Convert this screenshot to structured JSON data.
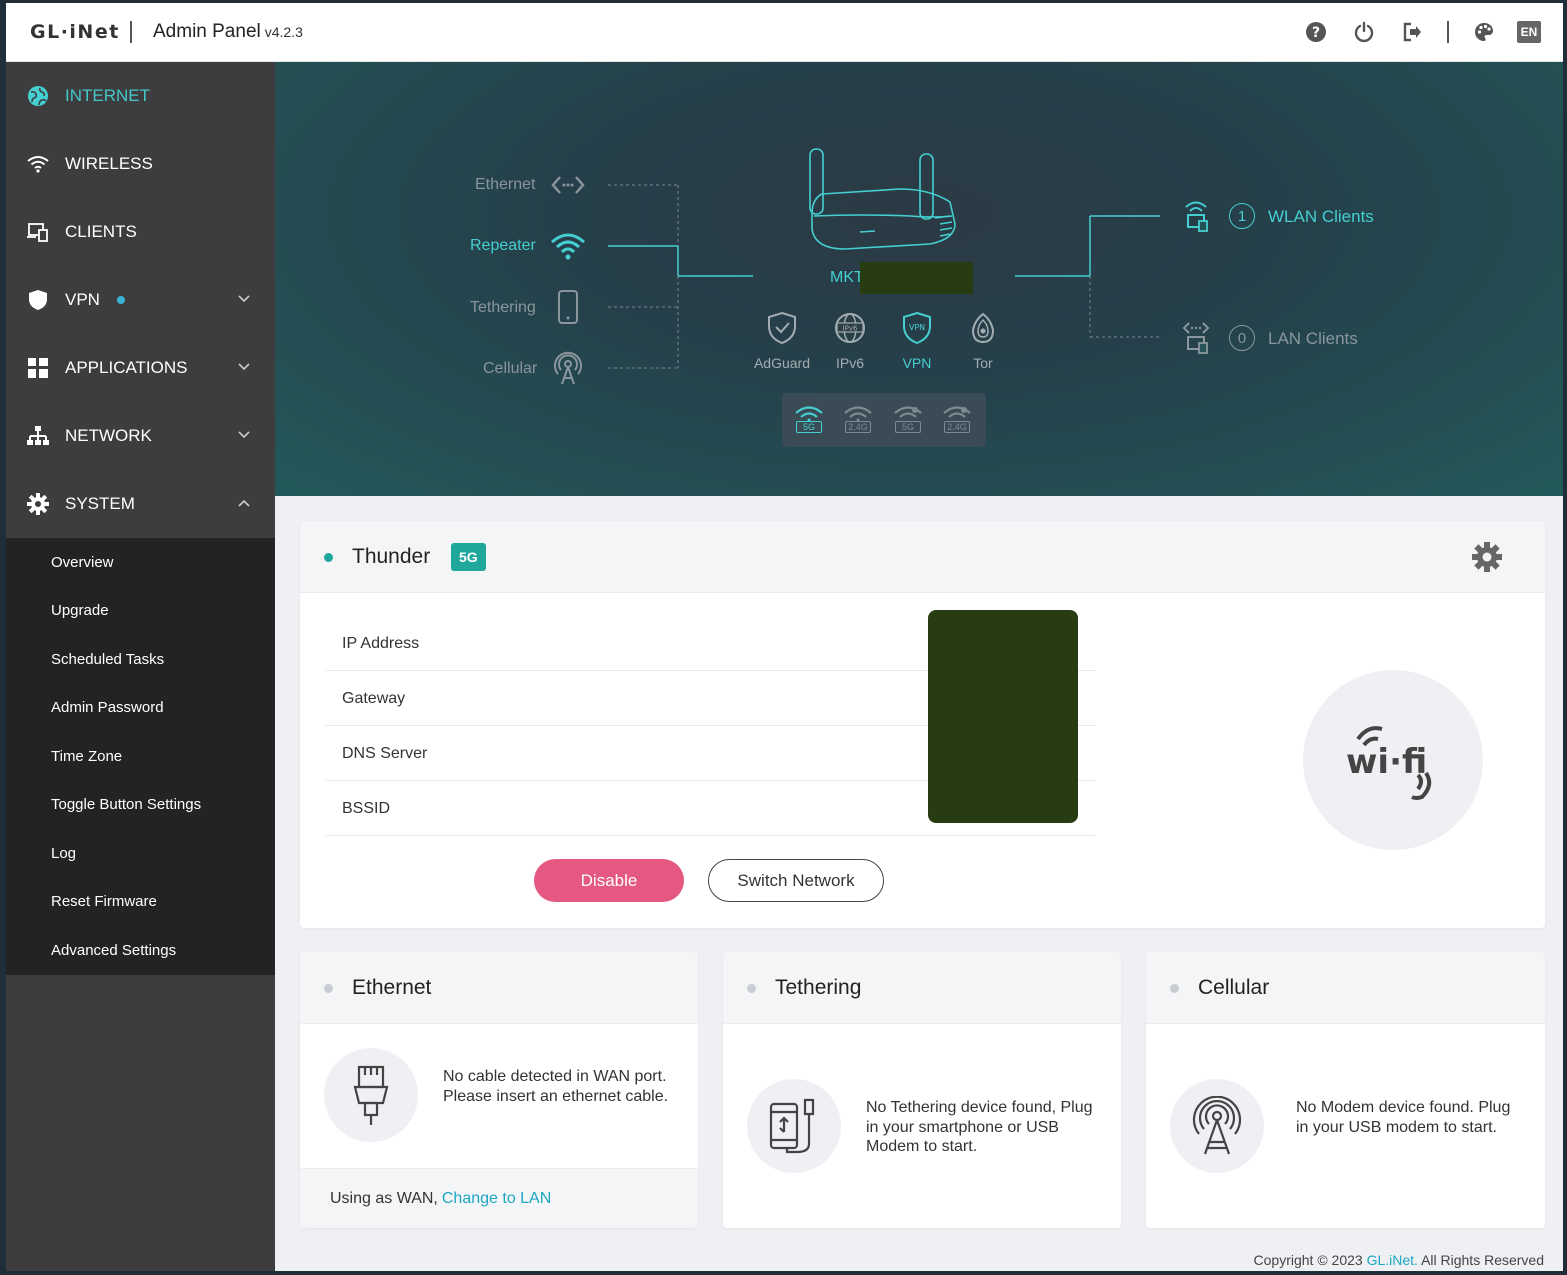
{
  "header": {
    "logo": "GL·iNet",
    "title": "Admin Panel",
    "version": "v4.2.3",
    "lang": "EN",
    "icons": [
      "help-icon",
      "power-icon",
      "logout-icon",
      "palette-icon"
    ]
  },
  "sidebar": {
    "items": [
      {
        "label": "INTERNET",
        "icon": "globe-icon",
        "active": true
      },
      {
        "label": "WIRELESS",
        "icon": "wifi-icon"
      },
      {
        "label": "CLIENTS",
        "icon": "devices-icon"
      },
      {
        "label": "VPN",
        "icon": "shield-icon"
      },
      {
        "label": "APPLICATIONS",
        "icon": "apps-icon"
      },
      {
        "label": "NETWORK",
        "icon": "network-icon"
      },
      {
        "label": "SYSTEM",
        "icon": "gear-icon"
      }
    ],
    "system_sub": [
      "Overview",
      "Upgrade",
      "Scheduled Tasks",
      "Admin Password",
      "Time Zone",
      "Toggle Button Settings",
      "Log",
      "Reset Firmware",
      "Advanced Settings"
    ]
  },
  "banner": {
    "sources": [
      "Ethernet",
      "Repeater",
      "Tethering",
      "Cellular"
    ],
    "device_name": "MKT",
    "services": [
      "AdGuard",
      "IPv6",
      "VPN",
      "Tor"
    ],
    "bands": [
      "5G",
      "2.4G",
      "5G",
      "2.4G"
    ],
    "wlan_count": "1",
    "wlan_label": "WLAN Clients",
    "lan_count": "0",
    "lan_label": "LAN Clients"
  },
  "repeater": {
    "ssid": "Thunder",
    "band": "5G",
    "fields": [
      "IP Address",
      "Gateway",
      "DNS Server",
      "BSSID"
    ],
    "disable_label": "Disable",
    "switch_label": "Switch Network"
  },
  "ethernet": {
    "title": "Ethernet",
    "message": "No cable detected in WAN port. Please insert an ethernet cable.",
    "footer_text": "Using as WAN,",
    "footer_link": "Change to LAN"
  },
  "tethering": {
    "title": "Tethering",
    "message": "No Tethering device found, Plug in your smartphone or USB Modem to start."
  },
  "cellular": {
    "title": "Cellular",
    "message": "No Modem device found. Plug in your USB modem to start."
  },
  "footer": {
    "copyright": "Copyright © 2023",
    "brand": "GL.iNet.",
    "rights": "All Rights Reserved"
  },
  "colors": {
    "accent": "#45cfd1",
    "sidebar_bg": "#3d3d3f",
    "submenu_bg": "#232325",
    "disable_btn": "#e45882",
    "badge": "#1fa79c",
    "link": "#1fa7c4"
  }
}
